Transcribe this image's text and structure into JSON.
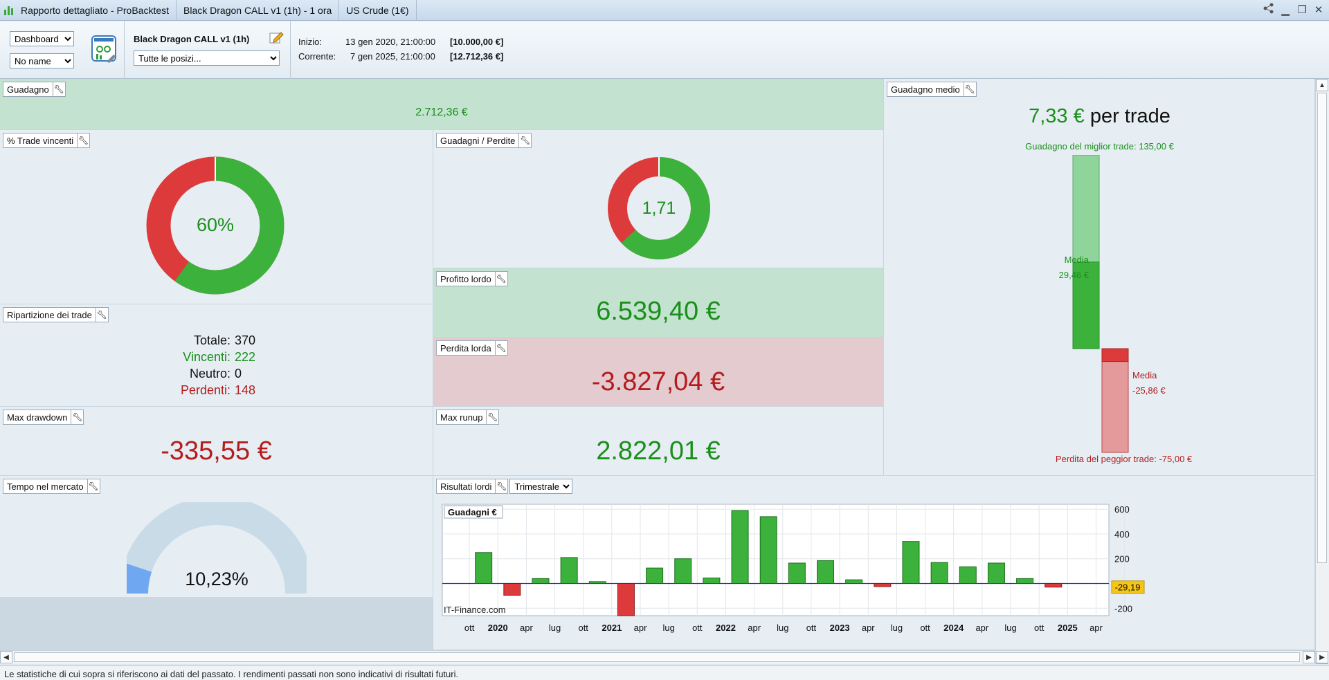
{
  "window": {
    "tabs": [
      "Rapporto dettagliato - ProBacktest",
      "Black Dragon CALL v1 (1h) - 1 ora",
      "US Crude (1€)"
    ]
  },
  "toolbar": {
    "view_select": "Dashboard",
    "name_select": "No name",
    "system_name": "Black Dragon CALL v1 (1h)",
    "positions_select": "Tutte le posizi...",
    "start_label": "Inizio:",
    "start_date": "13 gen 2020, 21:00:00",
    "start_capital": "[10.000,00 €]",
    "current_label": "Corrente:",
    "current_date": "7 gen 2025, 21:00:00",
    "current_capital": "[12.712,36 €]"
  },
  "gain": {
    "label": "Guadagno",
    "value": "2.712,36 €"
  },
  "win_pct": {
    "label": "% Trade vincenti",
    "value": "60%",
    "fraction": 0.6
  },
  "gain_loss": {
    "label": "Guadagni / Perdite",
    "value": "1,71",
    "fraction": 0.631
  },
  "gross_profit": {
    "label": "Profitto lordo",
    "value": "6.539,40 €"
  },
  "gross_loss": {
    "label": "Perdita lorda",
    "value": "-3.827,04 €"
  },
  "breakdown": {
    "label": "Ripartizione dei trade",
    "total_label": "Totale:",
    "total": "370",
    "win_label": "Vincenti:",
    "win": "222",
    "neutral_label": "Neutro:",
    "neutral": "0",
    "loss_label": "Perdenti:",
    "loss": "148"
  },
  "max_drawdown": {
    "label": "Max drawdown",
    "value": "-335,55 €"
  },
  "max_runup": {
    "label": "Max runup",
    "value": "2.822,01 €"
  },
  "avg_gain": {
    "label": "Guadagno medio",
    "value": "7,33 €",
    "suffix": "per trade",
    "best_label": "Guadagno del miglior trade: 135,00 €",
    "worst_label": "Perdita del peggior trade: -75,00 €",
    "avg_win_label": "Media",
    "avg_win_value": "29,46 €",
    "avg_loss_label": "Media",
    "avg_loss_value": "-25,86 €",
    "best": 135,
    "avg_win": 29.46,
    "avg_loss": -25.86,
    "worst": -75
  },
  "market_time": {
    "label": "Tempo nel mercato",
    "value": "10,23%",
    "fraction": 0.1023
  },
  "chart_panel": {
    "label": "Risultati lordi",
    "period_select": "Trimestrale"
  },
  "chart_data": {
    "type": "bar",
    "title": "Guadagni €",
    "watermark": "IT-Finance.com",
    "last_value_label": "-29,19",
    "ylim": [
      -260,
      640
    ],
    "yticks": [
      600,
      400,
      200,
      -200
    ],
    "x_labels": [
      {
        "t": "ott",
        "b": false
      },
      {
        "t": "2020",
        "b": true
      },
      {
        "t": "apr",
        "b": false
      },
      {
        "t": "lug",
        "b": false
      },
      {
        "t": "ott",
        "b": false
      },
      {
        "t": "2021",
        "b": true
      },
      {
        "t": "apr",
        "b": false
      },
      {
        "t": "lug",
        "b": false
      },
      {
        "t": "ott",
        "b": false
      },
      {
        "t": "2022",
        "b": true
      },
      {
        "t": "apr",
        "b": false
      },
      {
        "t": "lug",
        "b": false
      },
      {
        "t": "ott",
        "b": false
      },
      {
        "t": "2023",
        "b": true
      },
      {
        "t": "apr",
        "b": false
      },
      {
        "t": "lug",
        "b": false
      },
      {
        "t": "ott",
        "b": false
      },
      {
        "t": "2024",
        "b": true
      },
      {
        "t": "apr",
        "b": false
      },
      {
        "t": "lug",
        "b": false
      },
      {
        "t": "ott",
        "b": false
      },
      {
        "t": "2025",
        "b": true
      },
      {
        "t": "apr",
        "b": false
      }
    ],
    "values": [
      250,
      -95,
      40,
      210,
      15,
      -260,
      125,
      200,
      45,
      590,
      540,
      165,
      185,
      30,
      -25,
      340,
      170,
      135,
      165,
      40,
      -29.19
    ]
  },
  "disclaimer": "Le statistiche di cui sopra si riferiscono ai dati del passato. I rendimenti passati non sono indicativi di risultati futuri."
}
